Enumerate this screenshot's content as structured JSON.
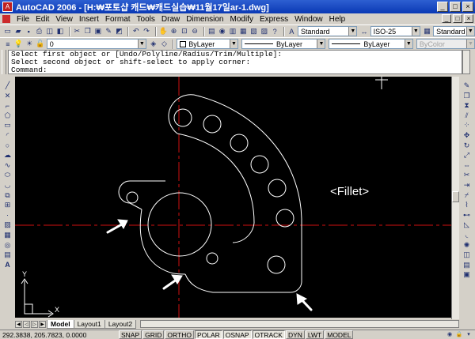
{
  "window": {
    "app_name": "AutoCAD 2006",
    "title": "AutoCAD 2006 - [H:₩포토샵 캐드₩캐드실습₩11월17일ar-1.dwg]"
  },
  "menu": [
    "File",
    "Edit",
    "View",
    "Insert",
    "Format",
    "Tools",
    "Draw",
    "Dimension",
    "Modify",
    "Express",
    "Window",
    "Help"
  ],
  "toolbar": {
    "text_style": "Standard",
    "dim_style": "ISO-25",
    "table_style": "Standard",
    "layer": "0",
    "color": "ByLayer",
    "linetype": "ByLayer",
    "lineweight": "ByLayer",
    "plot_style": "ByColor"
  },
  "command": {
    "history": [
      "Select first object or [Undo/Polyline/Radius/Trim/Multiple]:",
      "Select second object or shift-select to apply corner:"
    ],
    "prompt": "Command:"
  },
  "drawing": {
    "annotation": "<Fillet>",
    "ucs_x": "X",
    "ucs_y": "Y",
    "colors": {
      "background": "#000000",
      "geometry": "#ffffff",
      "centerline": "#d01010"
    }
  },
  "tabs": [
    "Model",
    "Layout1",
    "Layout2"
  ],
  "active_tab": "Model",
  "status": {
    "coords": "292.3838, 205.7823, 0.0000",
    "toggles": [
      {
        "label": "SNAP",
        "on": false
      },
      {
        "label": "GRID",
        "on": false
      },
      {
        "label": "ORTHO",
        "on": false
      },
      {
        "label": "POLAR",
        "on": true
      },
      {
        "label": "OSNAP",
        "on": true
      },
      {
        "label": "OTRACK",
        "on": true
      },
      {
        "label": "DYN",
        "on": false
      },
      {
        "label": "LWT",
        "on": false
      },
      {
        "label": "MODEL",
        "on": false
      }
    ]
  }
}
